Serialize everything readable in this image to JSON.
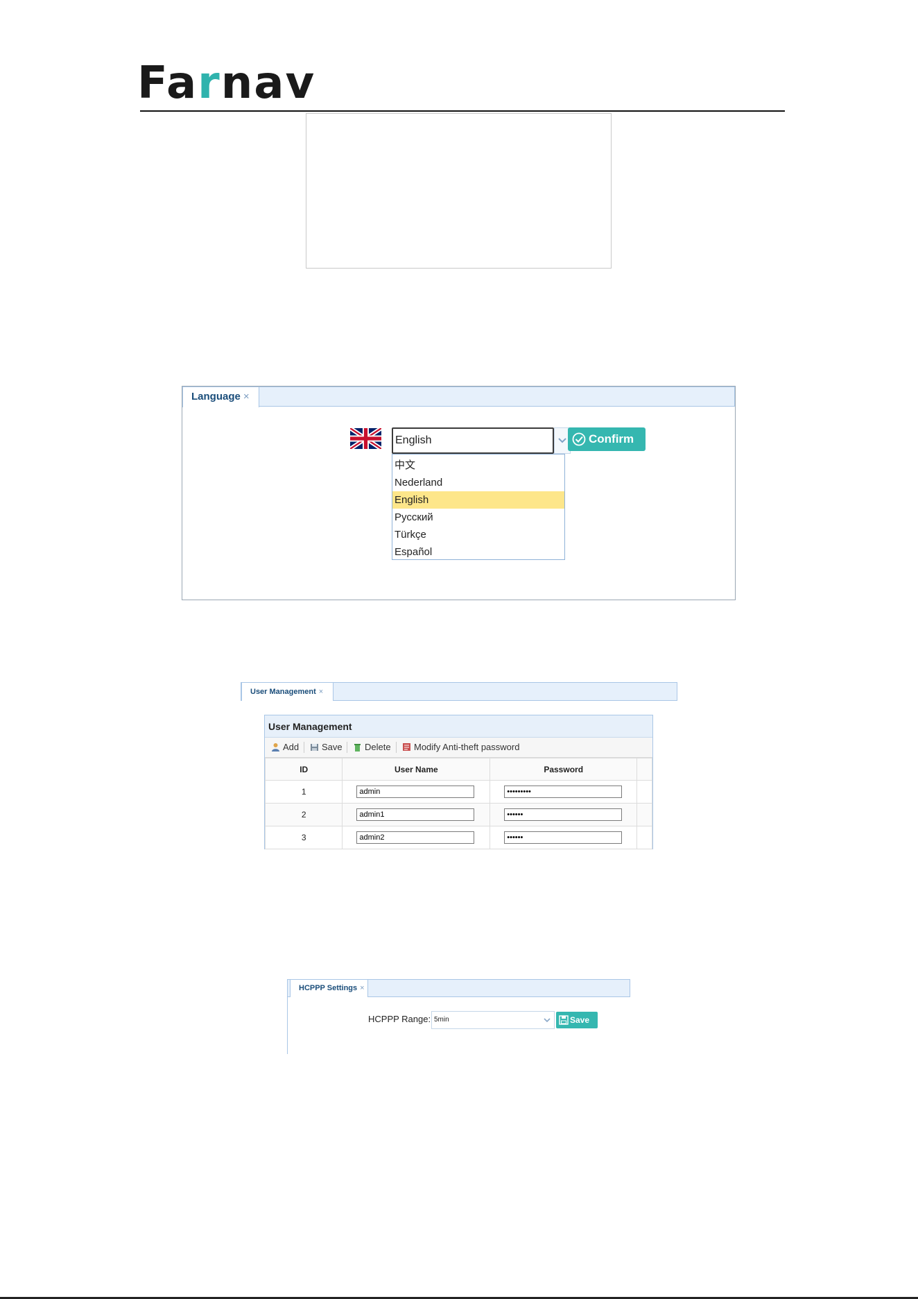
{
  "logo": {
    "brand_prefix": "Fa",
    "brand_accent": "r",
    "brand_suffix": "nav"
  },
  "language": {
    "tab_label": "Language",
    "tab_close": "×",
    "selected": "English",
    "confirm_label": "Confirm",
    "options": [
      "中文",
      "Nederland",
      "English",
      "Русский",
      "Türkçe",
      "Español"
    ],
    "highlighted_option": "English"
  },
  "user_management": {
    "tab_label": "User Management",
    "tab_close": "×",
    "panel_title": "User Management",
    "toolbar": {
      "add": "Add",
      "save": "Save",
      "delete": "Delete",
      "modify": "Modify Anti-theft password"
    },
    "columns": {
      "id": "ID",
      "user_name": "User Name",
      "password": "Password"
    },
    "rows": [
      {
        "id": "1",
        "user_name": "admin",
        "password": "•••••••••"
      },
      {
        "id": "2",
        "user_name": "admin1",
        "password": "••••••"
      },
      {
        "id": "3",
        "user_name": "admin2",
        "password": "••••••"
      }
    ]
  },
  "hcppp": {
    "tab_label": "HCPPP Settings",
    "tab_close": "×",
    "range_label": "HCPPP Range:",
    "range_value": "5min",
    "save_label": "Save"
  },
  "colors": {
    "accent": "#35b7b0",
    "tab_bg": "#e6f0fb",
    "highlight": "#fde68a"
  }
}
